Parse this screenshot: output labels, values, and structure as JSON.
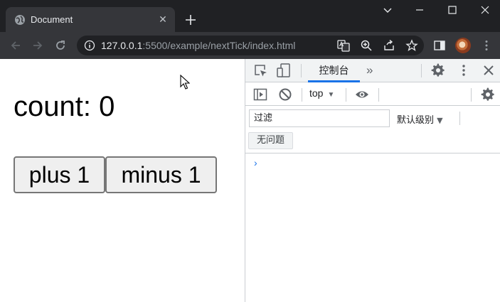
{
  "window": {
    "tab_title": "Document",
    "tab_close_glyph": "✕",
    "new_tab_glyph": "+"
  },
  "toolbar": {
    "url_host": "127.0.0.1",
    "url_path": ":5500/example/nextTick/index.html"
  },
  "page": {
    "count_text": "count: 0",
    "plus_label": "plus 1",
    "minus_label": "minus 1"
  },
  "devtools": {
    "console_tab_label": "控制台",
    "more_tabs_glyph": "»",
    "context_label": "top",
    "context_caret": "▼",
    "filter_placeholder": "过滤",
    "levels_label": "默认级别",
    "levels_caret": "▼",
    "no_issues_label": "无问题",
    "prompt_glyph": "›"
  },
  "colors": {
    "chrome_dark": "#202124",
    "chrome_toolbar": "#35363a",
    "devtools_accent": "#1a73e8"
  }
}
